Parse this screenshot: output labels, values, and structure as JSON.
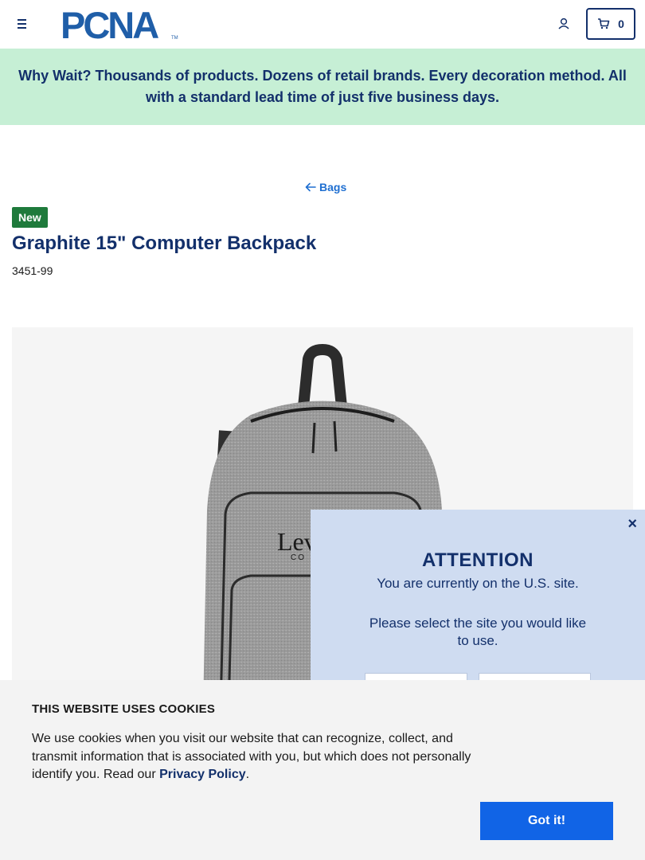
{
  "header": {
    "menu_icon": "hamburger-icon",
    "logo_text": "PCNA",
    "account_icon": "user-icon",
    "cart_icon": "cart-icon",
    "cart_count": "0"
  },
  "promo": {
    "text": "Why Wait? Thousands of products. Dozens of retail brands. Every decoration method. All with a standard lead time of just five business days."
  },
  "breadcrumb": {
    "back_icon": "arrow-left-icon",
    "label": "Bags"
  },
  "product": {
    "badge": "New",
    "title": "Graphite 15\" Computer Backpack",
    "sku": "3451-99",
    "image_logo_text": "Lev",
    "image_logo_subtext": "CO"
  },
  "attention_modal": {
    "close_label": "×",
    "heading": "ATTENTION",
    "message": "You are currently on the U.S. site.",
    "prompt": "Please select the site you would like to use."
  },
  "cookie_banner": {
    "heading": "THIS WEBSITE USES COOKIES",
    "text_before": "We use cookies when you visit our website that can recognize, collect, and transmit information that is associated with you, but which does not personally identify you. Read our ",
    "link_label": "Privacy Policy",
    "text_after": ".",
    "button_label": "Got it!"
  },
  "colors": {
    "brand_navy": "#13306b",
    "promo_bg": "#c6efd5",
    "badge_green": "#1e7a3b",
    "link_blue": "#1f6fd1",
    "button_blue": "#1164e6",
    "modal_bg": "#cfdcf1"
  }
}
